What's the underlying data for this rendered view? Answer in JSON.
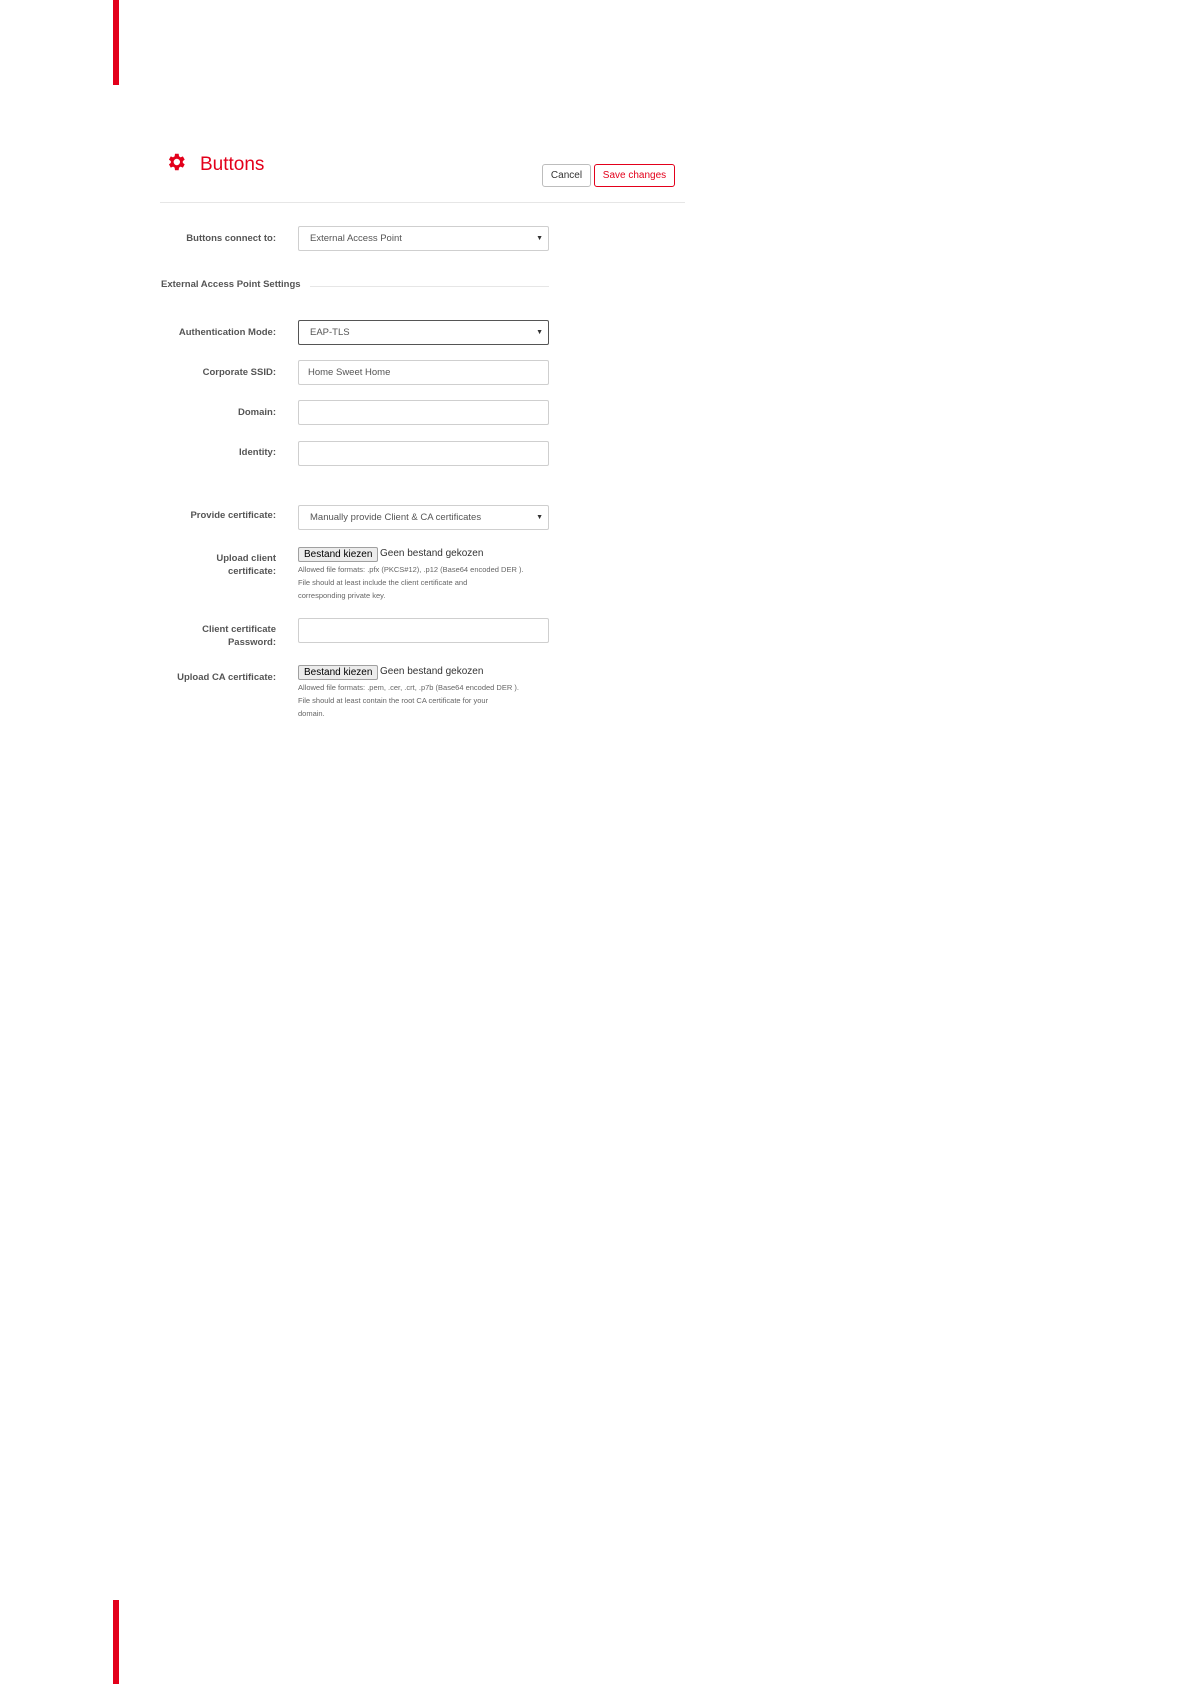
{
  "header": {
    "title": "Buttons",
    "icon": "gear-icon",
    "cancel_label": "Cancel",
    "save_label": "Save changes"
  },
  "colors": {
    "accent": "#e3001b"
  },
  "form": {
    "connect_label": "Buttons connect to:",
    "connect_value": "External Access Point",
    "section_title": "External Access Point Settings",
    "auth_label": "Authentication Mode:",
    "auth_value": "EAP-TLS",
    "ssid_label": "Corporate SSID:",
    "ssid_placeholder": "Home Sweet Home",
    "domain_label": "Domain:",
    "domain_value": "",
    "identity_label": "Identity:",
    "identity_value": "",
    "provide_label": "Provide certificate:",
    "provide_value": "Manually provide Client & CA certificates",
    "client_cert_label_line1": "Upload client",
    "client_cert_label_line2": "certificate:",
    "client_cert_button": "Bestand kiezen",
    "client_cert_status": "Geen bestand gekozen",
    "client_cert_help_1": "Allowed file formats: .pfx (PKCS#12), .p12 (Base64 encoded DER ).",
    "client_cert_help_2": "File should at least include the client certificate and",
    "client_cert_help_3": "corresponding private key.",
    "client_pw_label_line1": "Client certificate",
    "client_pw_label_line2": "Password:",
    "client_pw_value": "",
    "ca_cert_label": "Upload CA certificate:",
    "ca_cert_button": "Bestand kiezen",
    "ca_cert_status": "Geen bestand gekozen",
    "ca_cert_help_1": "Allowed file formats: .pem, .cer, .crt, .p7b (Base64 encoded DER ).",
    "ca_cert_help_2": "File should at least contain the root CA certificate for your",
    "ca_cert_help_3": "domain."
  }
}
